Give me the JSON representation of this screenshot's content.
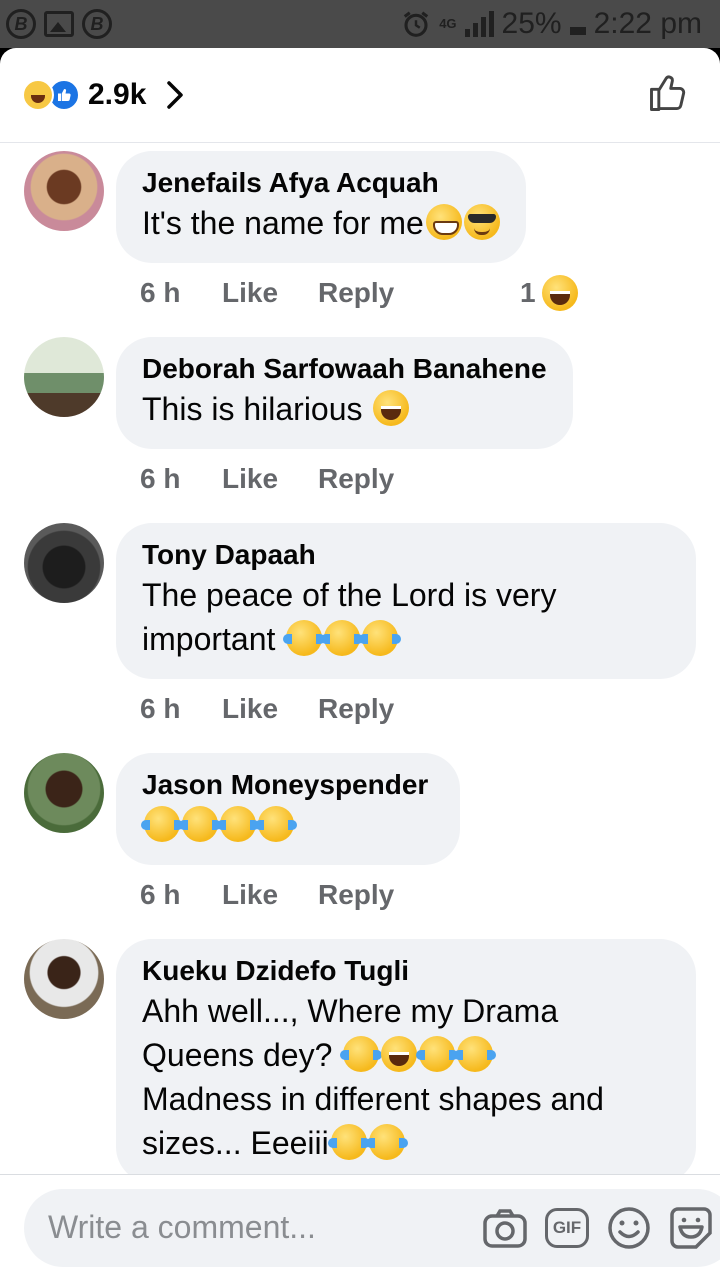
{
  "status_bar": {
    "network": "4G",
    "battery": "25%",
    "time": "2:22 pm"
  },
  "header": {
    "reaction_count": "2.9k",
    "reaction_icons": [
      "laugh-reaction-icon",
      "like-reaction-icon"
    ]
  },
  "comments": [
    {
      "author": "Jenefails Afya Acquah",
      "text": "It's the name for me",
      "emojis": [
        "grin",
        "cool"
      ],
      "time": "6 h",
      "like": "Like",
      "reply": "Reply",
      "reaction_count": "1",
      "avatar_color": "#d9b08a"
    },
    {
      "author": "Deborah Sarfowaah Banahene",
      "text": "This is hilarious ",
      "emojis": [
        "laugh"
      ],
      "time": "6 h",
      "like": "Like",
      "reply": "Reply",
      "avatar_color": "#6f8f6a"
    },
    {
      "author": "Tony Dapaah",
      "text": "The peace of the Lord is very important ",
      "emojis": [
        "cry",
        "cry",
        "cry"
      ],
      "time": "6 h",
      "like": "Like",
      "reply": "Reply",
      "avatar_color": "#2f2f2f"
    },
    {
      "author": "Jason Moneyspender",
      "text": "",
      "emojis": [
        "cry",
        "cry",
        "cry",
        "cry"
      ],
      "time": "6 h",
      "like": "Like",
      "reply": "Reply",
      "avatar_color": "#5a7a52"
    },
    {
      "author": "Kueku Dzidefo Tugli",
      "text_lines": [
        "Ahh well..., Where my Drama",
        "Queens dey? ",
        "Madness in different shapes and",
        "sizes... Eeeiii"
      ],
      "emojis": [
        "cry",
        "laugh",
        "cry",
        "cry",
        "cry",
        "cry"
      ],
      "avatar_color": "#7a6a55"
    }
  ],
  "composer": {
    "placeholder": "Write a comment...",
    "gif_label": "GIF"
  }
}
